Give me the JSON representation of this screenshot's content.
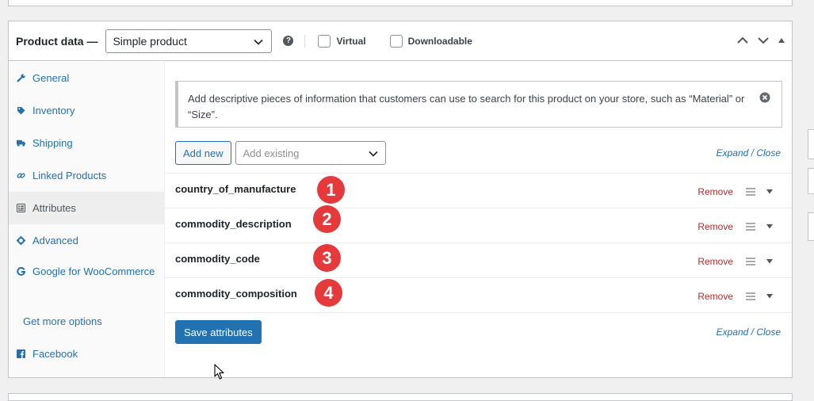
{
  "header": {
    "title": "Product data —",
    "product_type": "Simple product",
    "help_icon": "question-circle-icon",
    "virtual_label": "Virtual",
    "downloadable_label": "Downloadable"
  },
  "sidebar": {
    "items": [
      {
        "label": "General",
        "icon": "wrench-icon"
      },
      {
        "label": "Inventory",
        "icon": "tag-icon"
      },
      {
        "label": "Shipping",
        "icon": "truck-icon"
      },
      {
        "label": "Linked Products",
        "icon": "link-icon"
      },
      {
        "label": "Attributes",
        "icon": "list-icon"
      },
      {
        "label": "Advanced",
        "icon": "gear-icon"
      },
      {
        "label": "Google for WooCommerce",
        "icon": "google-icon"
      },
      {
        "label": "Get more options"
      },
      {
        "label": "Facebook",
        "icon": "facebook-icon"
      }
    ]
  },
  "notice": {
    "text": "Add descriptive pieces of information that customers can use to search for this product on your store, such as “Material” or “Size”."
  },
  "toolbar": {
    "add_new": "Add new",
    "add_existing_placeholder": "Add existing",
    "expand": "Expand",
    "separator": " / ",
    "close": "Close"
  },
  "attributes": [
    {
      "name": "country_of_manufacture",
      "marker": "1",
      "remove": "Remove"
    },
    {
      "name": "commodity_description",
      "marker": "2",
      "remove": "Remove"
    },
    {
      "name": "commodity_code",
      "marker": "3",
      "remove": "Remove"
    },
    {
      "name": "commodity_composition",
      "marker": "4",
      "remove": "Remove"
    }
  ],
  "footer": {
    "save": "Save attributes",
    "expand": "Expand",
    "separator": " / ",
    "close": "Close"
  },
  "colors": {
    "accent": "#2271b1",
    "remove": "#b32d2e",
    "marker": "#e5393b"
  }
}
